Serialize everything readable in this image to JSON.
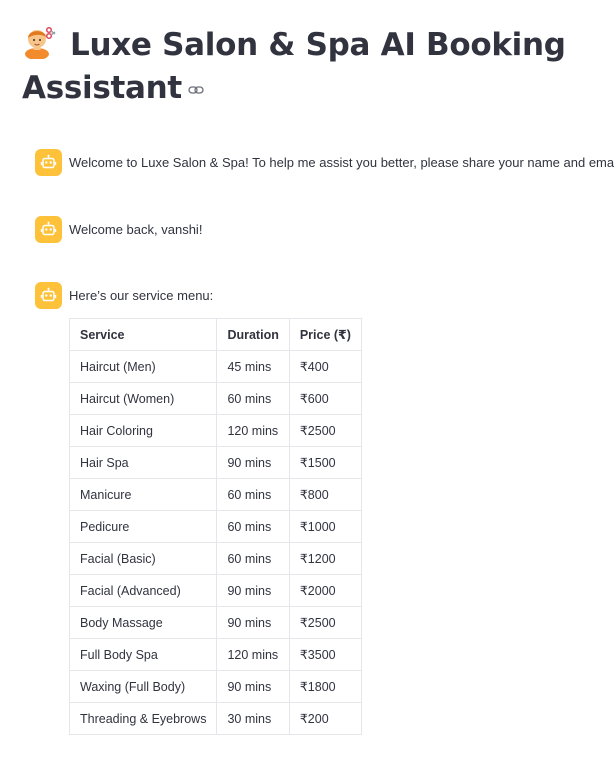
{
  "header": {
    "title_icon": "person-getting-haircut-emoji",
    "title": "Luxe Salon & Spa AI Booking Assistant",
    "anchor_icon": "link-icon"
  },
  "colors": {
    "avatar_bg": "#fdc23a",
    "text": "#31333f",
    "border": "#e6e6ea"
  },
  "messages": [
    {
      "role": "assistant",
      "icon": "robot-icon",
      "text": "Welcome to Luxe Salon & Spa! To help me assist you better, please share your name and email."
    },
    {
      "role": "assistant",
      "icon": "robot-icon",
      "text": "Welcome back, vanshi!"
    },
    {
      "role": "assistant",
      "icon": "robot-icon",
      "text": "Here’s our service menu:"
    }
  ],
  "service_table": {
    "headers": [
      "Service",
      "Duration",
      "Price (₹)"
    ],
    "rows": [
      [
        "Haircut (Men)",
        "45 mins",
        "₹400"
      ],
      [
        "Haircut (Women)",
        "60 mins",
        "₹600"
      ],
      [
        "Hair Coloring",
        "120 mins",
        "₹2500"
      ],
      [
        "Hair Spa",
        "90 mins",
        "₹1500"
      ],
      [
        "Manicure",
        "60 mins",
        "₹800"
      ],
      [
        "Pedicure",
        "60 mins",
        "₹1000"
      ],
      [
        "Facial (Basic)",
        "60 mins",
        "₹1200"
      ],
      [
        "Facial (Advanced)",
        "90 mins",
        "₹2000"
      ],
      [
        "Body Massage",
        "90 mins",
        "₹2500"
      ],
      [
        "Full Body Spa",
        "120 mins",
        "₹3500"
      ],
      [
        "Waxing (Full Body)",
        "90 mins",
        "₹1800"
      ],
      [
        "Threading & Eyebrows",
        "30 mins",
        "₹200"
      ]
    ]
  }
}
